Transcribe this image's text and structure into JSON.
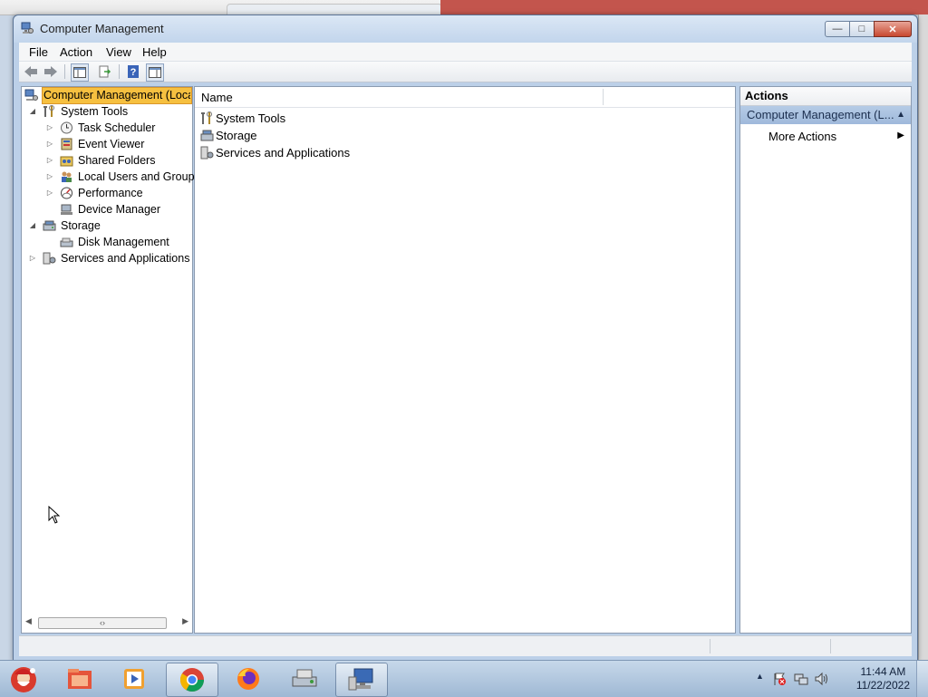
{
  "window": {
    "title": "Computer Management",
    "buttons": {
      "minimize": "—",
      "maximize": "□",
      "close": "✕"
    }
  },
  "menu": [
    "File",
    "Action",
    "View",
    "Help"
  ],
  "toolbar": {
    "icons": [
      "back-arrow-icon",
      "forward-arrow-icon",
      "show-hide-tree-icon",
      "export-list-icon",
      "help-icon",
      "show-hide-action-pane-icon"
    ]
  },
  "tree": {
    "root": "Computer Management (Local",
    "items": [
      {
        "label": "System Tools",
        "icon": "tools-icon"
      },
      {
        "label": "Task Scheduler",
        "icon": "clock-icon"
      },
      {
        "label": "Event Viewer",
        "icon": "event-viewer-icon"
      },
      {
        "label": "Shared Folders",
        "icon": "shared-folder-icon"
      },
      {
        "label": "Local Users and Groups",
        "icon": "users-icon"
      },
      {
        "label": "Performance",
        "icon": "performance-icon"
      },
      {
        "label": "Device Manager",
        "icon": "device-manager-icon"
      },
      {
        "label": "Storage",
        "icon": "storage-icon"
      },
      {
        "label": "Disk Management",
        "icon": "disk-icon"
      },
      {
        "label": "Services and Applications",
        "icon": "services-icon"
      }
    ],
    "scroll_thumb": "‹›"
  },
  "center": {
    "column_header": "Name",
    "rows": [
      "System Tools",
      "Storage",
      "Services and Applications"
    ]
  },
  "actions": {
    "header": "Actions",
    "group": "Computer Management (L...",
    "items": [
      "More Actions"
    ]
  },
  "taskbar": {
    "apps": [
      "start-orb-icon",
      "file-explorer-icon",
      "media-player-icon",
      "chrome-icon",
      "firefox-icon",
      "disk-management-app-icon",
      "computer-management-app-icon"
    ],
    "time": "11:44 AM",
    "date": "11/22/2022"
  },
  "colors": {
    "selection": "#f6c040",
    "action_group": "#a9c1e1",
    "window_frame": "#bcd0e8"
  }
}
